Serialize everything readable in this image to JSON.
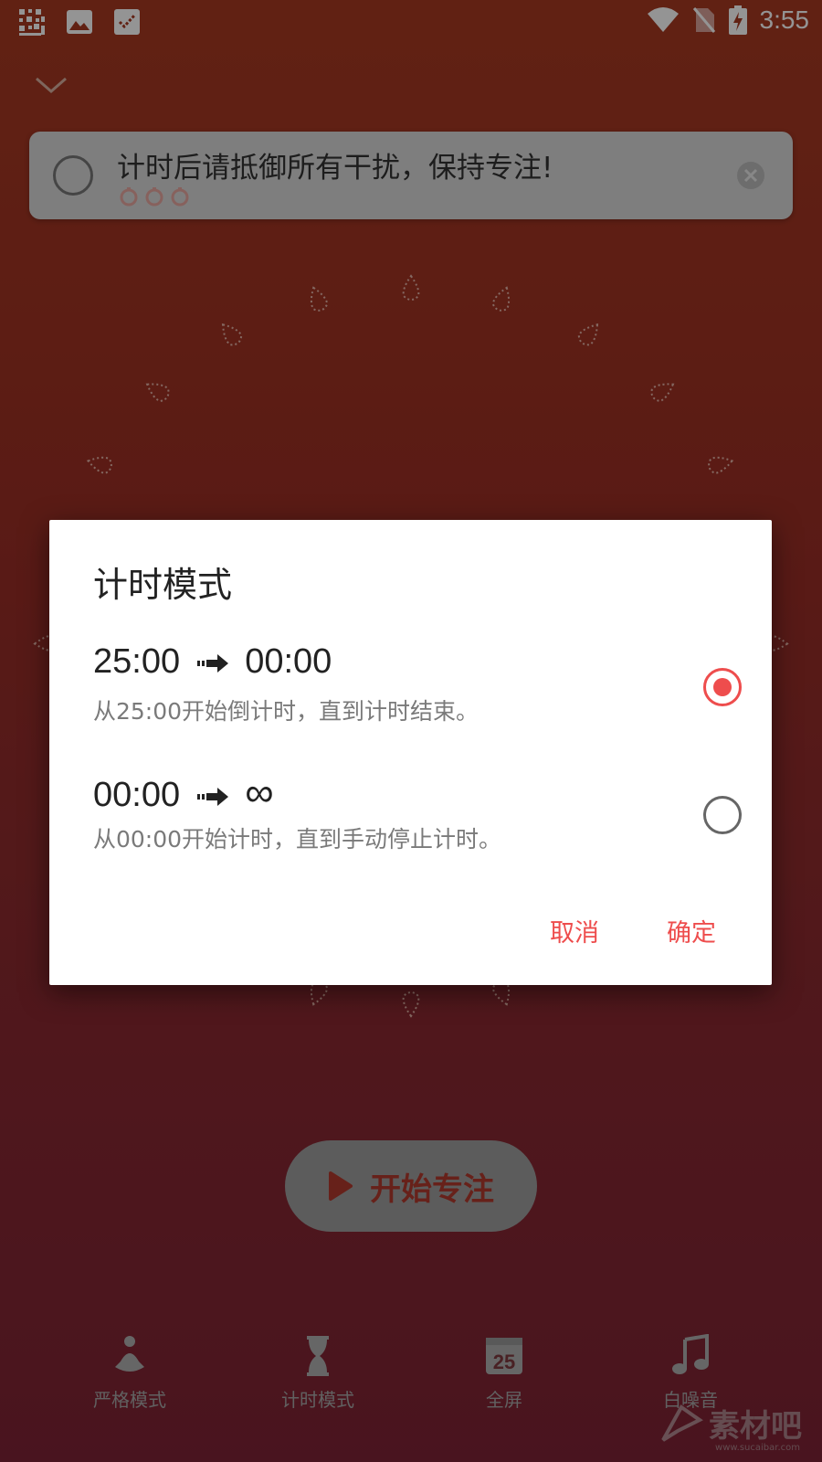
{
  "status_bar": {
    "time": "3:55",
    "left_icons": [
      "grid-app-icon",
      "image-icon",
      "checklist-icon"
    ],
    "right_icons": [
      "wifi-icon",
      "no-sim-icon",
      "battery-charging-icon"
    ]
  },
  "banner": {
    "text": "计时后请抵御所有干扰，保持专注!"
  },
  "focus_button": {
    "label": "开始专注"
  },
  "bottom_nav": {
    "items": [
      {
        "label": "严格模式",
        "icon": "meditation-icon"
      },
      {
        "label": "计时模式",
        "icon": "hourglass-icon"
      },
      {
        "label": "全屏",
        "icon": "calendar-25-icon"
      },
      {
        "label": "白噪音",
        "icon": "music-note-icon"
      }
    ]
  },
  "dialog": {
    "title": "计时模式",
    "options": [
      {
        "main_from": "25:00",
        "main_to": "00:00",
        "sub": "从25:00开始倒计时，直到计时结束。",
        "selected": true
      },
      {
        "main_from": "00:00",
        "main_to": "∞",
        "sub": "从00:00开始计时，直到手动停止计时。",
        "selected": false
      }
    ],
    "cancel_label": "取消",
    "confirm_label": "确定",
    "accent_color": "#ee4d4d"
  },
  "watermark": {
    "text": "素材吧",
    "sub": "www.sucaibar.com"
  }
}
